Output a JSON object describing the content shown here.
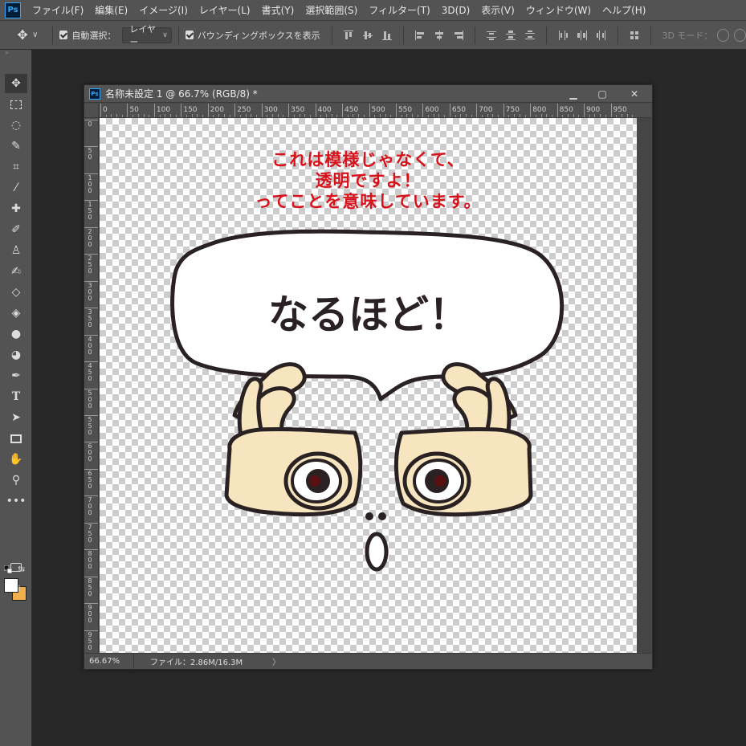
{
  "app": {
    "logo": "Ps"
  },
  "menu": [
    "ファイル(F)",
    "編集(E)",
    "イメージ(I)",
    "レイヤー(L)",
    "書式(Y)",
    "選択範囲(S)",
    "フィルター(T)",
    "3D(D)",
    "表示(V)",
    "ウィンドウ(W)",
    "ヘルプ(H)"
  ],
  "options": {
    "auto_select_label": "自動選択：",
    "auto_select_target": "レイヤー",
    "bounding_box_label": "バウンディングボックスを表示",
    "mode_3d_label": "3D モード："
  },
  "tools": [
    "move-tool",
    "marquee-tool",
    "lasso-tool",
    "quick-select-tool",
    "crop-tool",
    "eyedropper-tool",
    "healing-brush-tool",
    "brush-tool",
    "clone-stamp-tool",
    "history-brush-tool",
    "eraser-tool",
    "paint-bucket-tool",
    "blur-tool",
    "dodge-tool",
    "pen-tool",
    "type-tool",
    "path-select-tool",
    "rectangle-tool",
    "hand-tool",
    "zoom-tool",
    "more-tools"
  ],
  "colors": {
    "foreground": "#ffffff",
    "background": "#f2b04d",
    "note_text": "#d8111b",
    "skin": "#f7e5c0"
  },
  "document": {
    "title": "名称未設定 1 @ 66.7% (RGB/8) *",
    "ps_badge": "Ps",
    "window_buttons": {
      "minimize": "▁",
      "restore": "▢",
      "close": "✕"
    },
    "ruler_top": [
      "0",
      "50",
      "100",
      "150",
      "200",
      "250",
      "300",
      "350",
      "400",
      "450",
      "500",
      "550",
      "600",
      "650",
      "700",
      "750",
      "800",
      "850",
      "900",
      "950"
    ],
    "ruler_left": [
      "0",
      "50",
      "100",
      "150",
      "200",
      "250",
      "300",
      "350",
      "400",
      "450",
      "500",
      "550",
      "600",
      "650",
      "700",
      "750",
      "800",
      "850",
      "900",
      "950"
    ],
    "status": {
      "zoom": "66.67%",
      "file": "ファイル：2.86M/16.3M",
      "arrow": "〉"
    }
  },
  "artwork": {
    "note_lines": [
      "これは模様じゃなくて、",
      "透明ですよ！",
      "ってことを意味しています。"
    ],
    "bubble_text": "なるほど！"
  }
}
